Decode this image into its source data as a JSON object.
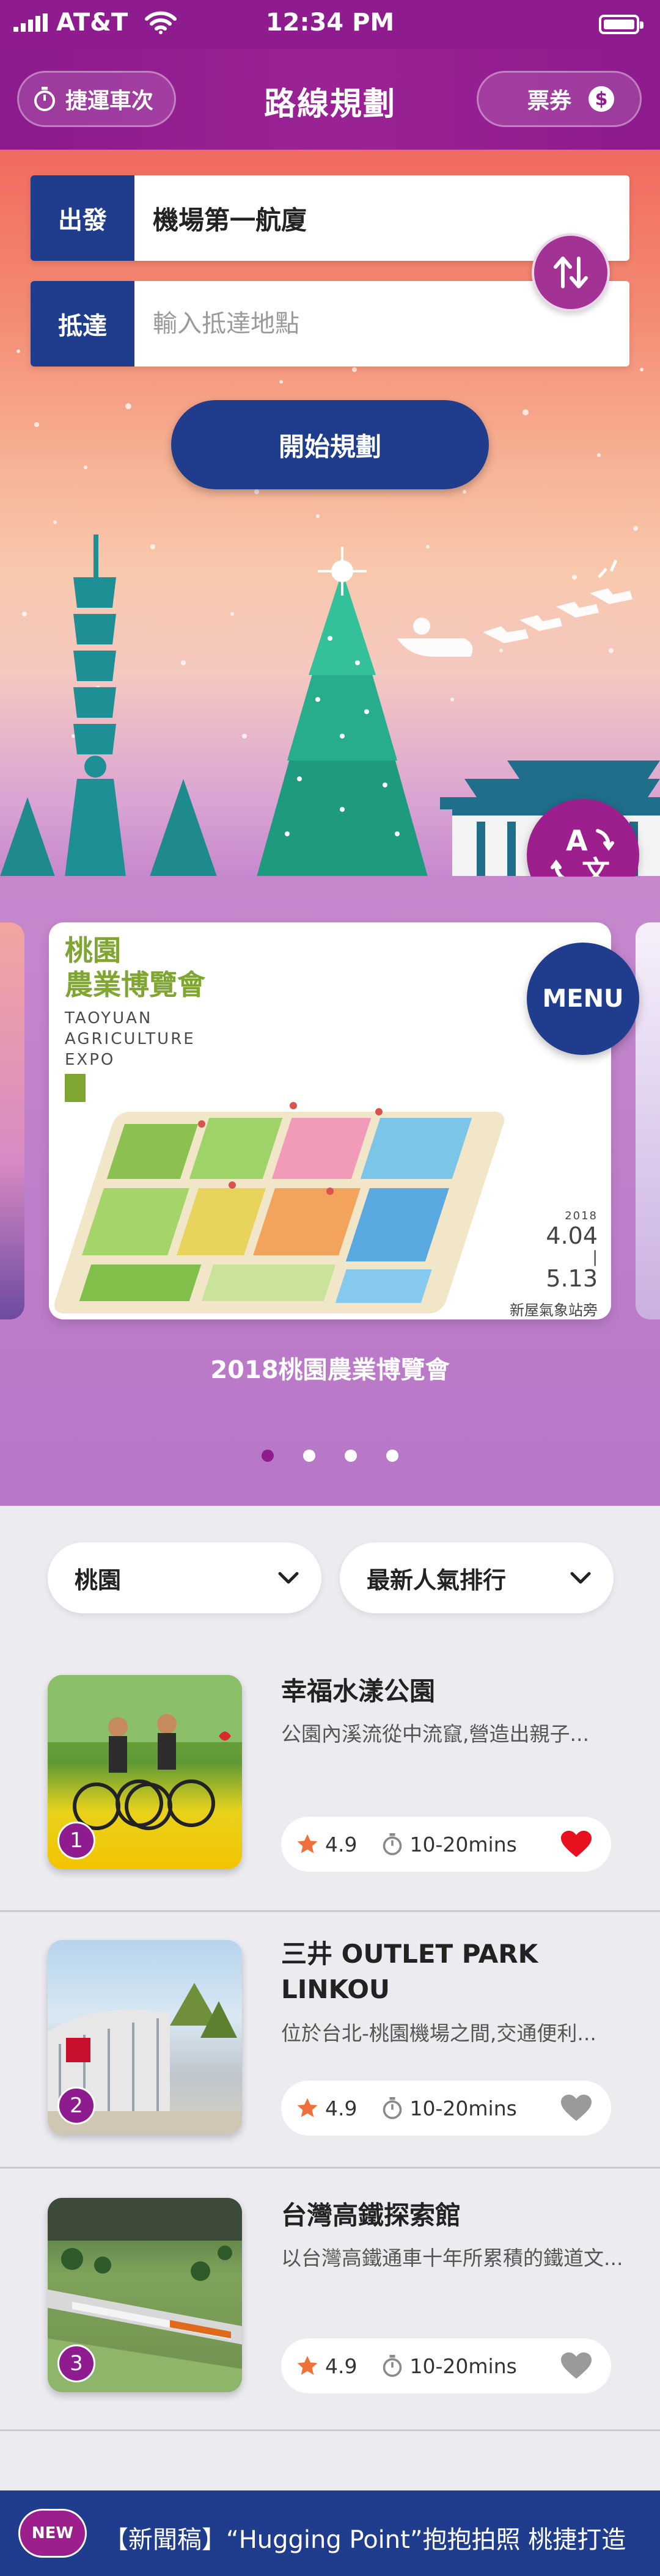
{
  "status_bar": {
    "carrier": "AT&T",
    "time": "12:34 PM"
  },
  "header": {
    "left_button": "捷運車次",
    "title": "路線規劃",
    "right_button": "票券",
    "dollar_symbol": "$"
  },
  "route": {
    "from_label": "出發",
    "from_value": "機場第一航廈",
    "to_label": "抵達",
    "to_placeholder": "輸入抵達地點",
    "plan_button": "開始規劃"
  },
  "translate_button": {
    "char_a": "A",
    "char_b": "文"
  },
  "banner": {
    "title_line1": "桃園",
    "title_line2": "農業博覽會",
    "en_line1": "TAOYUAN",
    "en_line2": "AGRICULTURE",
    "en_line3": "EXPO",
    "year": "2018",
    "date_start": "4.04",
    "date_sep": "|",
    "date_end": "5.13",
    "location": "新屋氣象站旁",
    "caption": "2018桃園農業博覽會",
    "menu_button": "MENU",
    "active_dot": 1,
    "dot_count": 4
  },
  "filters": {
    "region": "桃園",
    "sort": "最新人氣排行"
  },
  "places": [
    {
      "rank": "1",
      "name": "幸福水漾公園",
      "desc": "公園內溪流從中流竄,營造出親子...",
      "rating": "4.9",
      "duration": "10-20mins",
      "favorited": true
    },
    {
      "rank": "2",
      "name": "三井 OUTLET PARK LINKOU",
      "desc": "位於台北-桃園機場之間,交通便利...",
      "rating": "4.9",
      "duration": "10-20mins",
      "favorited": false
    },
    {
      "rank": "3",
      "name": "台灣高鐵探索館",
      "desc": "以台灣高鐵通車十年所累積的鐵道文...",
      "rating": "4.9",
      "duration": "10-20mins",
      "favorited": false
    }
  ],
  "ticker": {
    "badge": "NEW",
    "text": "【新聞稿】“Hugging Point”抱抱拍照 桃捷打造"
  },
  "colors": {
    "brand_purple": "#8e1c8f",
    "navy": "#1f3d8c",
    "heart_red": "#e8101e",
    "heart_gray": "#9a9a9a",
    "star_orange": "#f0703a"
  }
}
